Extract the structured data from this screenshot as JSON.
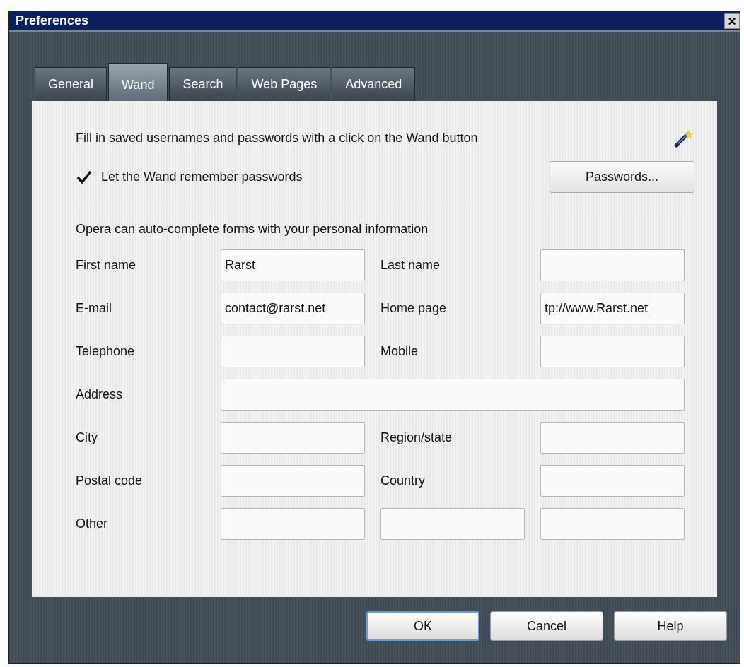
{
  "window": {
    "title": "Preferences",
    "close": "×"
  },
  "tabs": [
    {
      "label": "General",
      "selected": false
    },
    {
      "label": "Wand",
      "selected": true
    },
    {
      "label": "Search",
      "selected": false
    },
    {
      "label": "Web Pages",
      "selected": false
    },
    {
      "label": "Advanced",
      "selected": false
    }
  ],
  "wand": {
    "description": "Fill in saved usernames and passwords with a click on the Wand button",
    "remember": {
      "label": "Let the Wand remember passwords",
      "checked": true
    },
    "passwords_button": "Passwords..."
  },
  "personal": {
    "intro": "Opera can auto-complete forms with your personal information",
    "rows": [
      {
        "kind": "pair",
        "fields": [
          {
            "label": "First name",
            "value": "Rarst"
          },
          {
            "label": "Last name"
          }
        ]
      },
      {
        "kind": "pair",
        "fields": [
          {
            "label": "E-mail",
            "value": "contact@rarst.net"
          },
          {
            "label": "Home page",
            "value": "tp://www.Rarst.net"
          }
        ]
      },
      {
        "kind": "pair",
        "fields": [
          {
            "label": "Telephone"
          },
          {
            "label": "Mobile"
          }
        ]
      },
      {
        "kind": "wide",
        "fields": [
          {
            "label": "Address"
          }
        ]
      },
      {
        "kind": "pair",
        "fields": [
          {
            "label": "City"
          },
          {
            "label": "Region/state"
          }
        ]
      },
      {
        "kind": "pair",
        "fields": [
          {
            "label": "Postal code"
          },
          {
            "label": "Country"
          }
        ]
      },
      {
        "kind": "triple",
        "label": "Other"
      }
    ]
  },
  "buttons": [
    {
      "label": "OK",
      "selected": true
    },
    {
      "label": "Cancel",
      "selected": false
    },
    {
      "label": "Help",
      "selected": false
    }
  ]
}
